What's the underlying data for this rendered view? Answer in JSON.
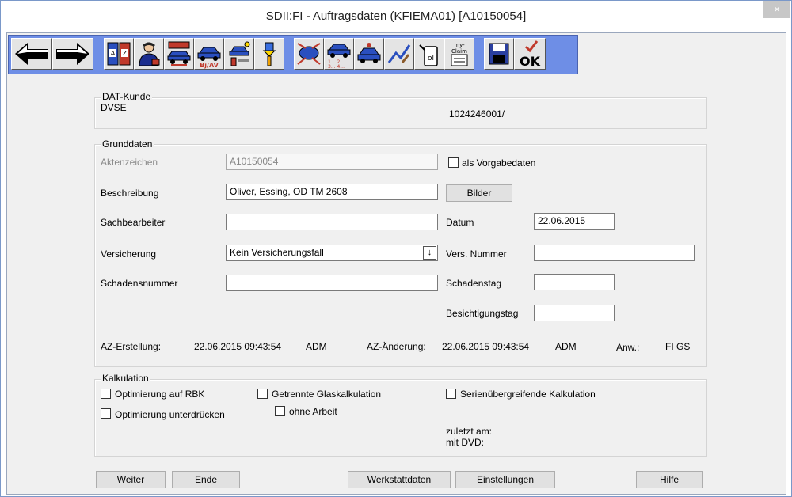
{
  "window": {
    "title": "SDII:FI - Auftragsdaten (KFIEMA01) [A10150054]",
    "close_glyph": "×"
  },
  "toolbar": {
    "items": [
      {
        "name": "back-arrow-icon",
        "label": "Zurück"
      },
      {
        "name": "forward-arrow-icon",
        "label": "Vor"
      },
      {
        "name": "binders-icon"
      },
      {
        "name": "person-icon"
      },
      {
        "name": "vehicles-icon"
      },
      {
        "name": "car-bjav-icon",
        "text": "Bj/AV"
      },
      {
        "name": "car-lift-icon"
      },
      {
        "name": "paint-gun-icon"
      },
      {
        "name": "parts-diagram-icon"
      },
      {
        "name": "car-list-icon",
        "text": "1... 2... 3... 4..."
      },
      {
        "name": "chart-hammer-icon"
      },
      {
        "name": "oil-can-icon",
        "text": "öl"
      },
      {
        "name": "myclaim-icon",
        "text": "my-Claim"
      },
      {
        "name": "save-icon"
      },
      {
        "name": "ok-icon",
        "text": "OK"
      }
    ]
  },
  "dat_kunde": {
    "group_label": "DAT-Kunde",
    "name": "DVSE",
    "number": "1024246001/"
  },
  "grunddaten": {
    "group_label": "Grunddaten",
    "aktenzeichen_label": "Aktenzeichen",
    "aktenzeichen_value": "A10150054",
    "vorgabedaten_label": "als Vorgabedaten",
    "beschreibung_label": "Beschreibung",
    "beschreibung_value": "Oliver, Essing, OD TM 2608",
    "bilder_button": "Bilder",
    "sachbearbeiter_label": "Sachbearbeiter",
    "sachbearbeiter_value": "",
    "datum_label": "Datum",
    "datum_value": "22.06.2015",
    "versicherung_label": "Versicherung",
    "versicherung_value": "Kein Versicherungsfall",
    "versicherung_dropdown_glyph": "↓",
    "vers_nummer_label": "Vers. Nummer",
    "vers_nummer_value": "",
    "schadensnummer_label": "Schadensnummer",
    "schadensnummer_value": "",
    "schadenstag_label": "Schadenstag",
    "schadenstag_value": "",
    "besichtigungstag_label": "Besichtigungstag",
    "besichtigungstag_value": "",
    "az_erstellung_label": "AZ-Erstellung:",
    "az_erstellung_value": "22.06.2015 09:43:54",
    "az_erstellung_user": "ADM",
    "az_aenderung_label": "AZ-Änderung:",
    "az_aenderung_value": "22.06.2015 09:43:54",
    "az_aenderung_user": "ADM",
    "anw_label": "Anw.:",
    "anw_value": "FI GS"
  },
  "kalkulation": {
    "group_label": "Kalkulation",
    "opt_rbk": "Optimierung auf RBK",
    "opt_unterdruecken": "Optimierung unterdrücken",
    "getrennte_glas": "Getrennte Glaskalkulation",
    "ohne_arbeit": "ohne Arbeit",
    "serien": "Serienübergreifende Kalkulation",
    "zuletzt_am": "zuletzt am:",
    "mit_dvd": "mit DVD:"
  },
  "buttons": {
    "weiter": "Weiter",
    "ende": "Ende",
    "werkstattdaten": "Werkstattdaten",
    "einstellungen": "Einstellungen",
    "hilfe": "Hilfe"
  }
}
